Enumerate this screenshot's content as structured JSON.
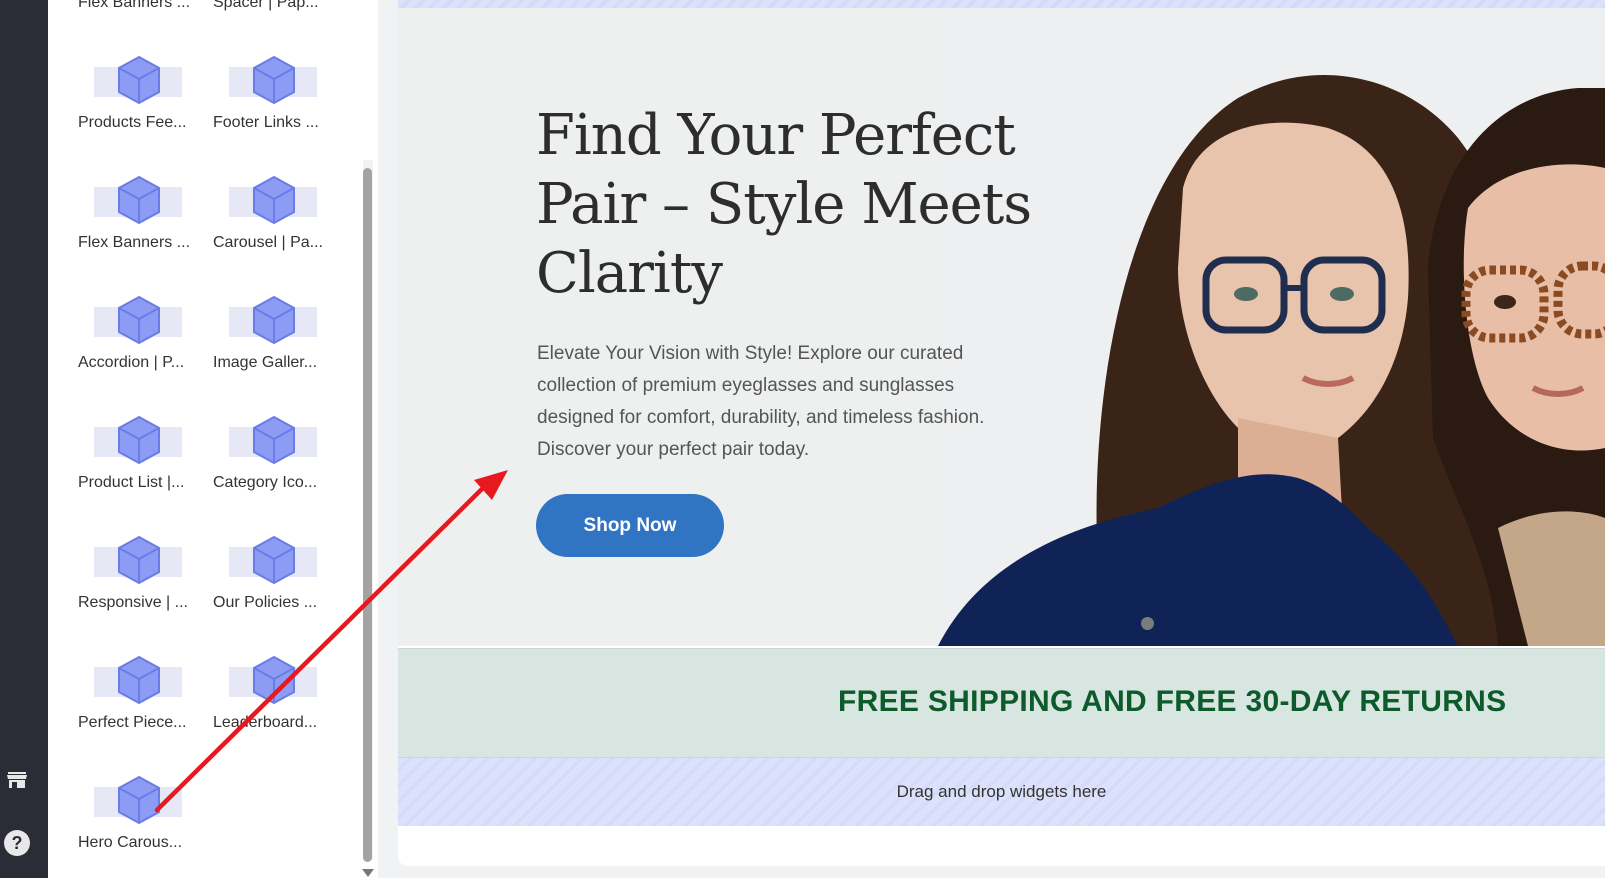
{
  "sidebar": {
    "top_labels": [
      "Flex Banners ...",
      "Spacer | Pap..."
    ],
    "widgets": [
      "Products Fee...",
      "Footer Links ...",
      "Flex Banners ...",
      "Carousel | Pa...",
      "Accordion | P...",
      "Image Galler...",
      "Product List |...",
      "Category Ico...",
      "Responsive | ...",
      "Our Policies ...",
      "Perfect Piece...",
      "Leaderboard...",
      "Hero Carous..."
    ]
  },
  "rail": {
    "icons": [
      "store-icon",
      "help-icon"
    ],
    "help_glyph": "?"
  },
  "hero": {
    "title": "Find Your Perfect Pair – Style Meets Clarity",
    "description": "Elevate Your Vision with Style! Explore our curated collection of premium eyeglasses and sunglasses designed for comfort, durability, and timeless fashion. Discover your perfect pair today.",
    "button": "Shop Now"
  },
  "banner": {
    "text": "FREE SHIPPING AND FREE 30-DAY RETURNS"
  },
  "dropzone": {
    "text": "Drag and drop widgets here"
  },
  "colors": {
    "accent": "#3274c4",
    "banner_text": "#0d5a2b",
    "banner_bg": "#d8e6e1",
    "arrow": "#e8191e",
    "cube": "#8c9cf5"
  }
}
